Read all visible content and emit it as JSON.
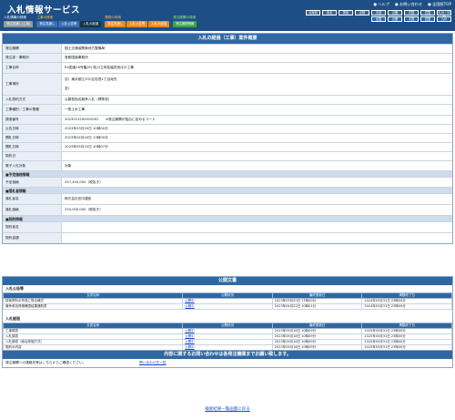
{
  "header": {
    "title": "入札情報サービス",
    "links": [
      "● ヘルプ",
      "● お問い合わせ",
      "● 全国版TOP"
    ],
    "regions_row1": [
      "北海道",
      "東北",
      "関東",
      "北陸",
      "中部",
      "近畿",
      "中国",
      "四国",
      "九州・沖縄"
    ],
    "regions_row2": [
      "全国",
      "近畿",
      "中国",
      "四国",
      "九州"
    ],
    "menu": [
      {
        "caption": "入札情報の検索",
        "tabs": [
          {
            "label": "発注見通し(工事)",
            "style": "gray"
          }
        ]
      },
      {
        "caption": "工事の検索",
        "tabs": [
          {
            "label": "発注見通し",
            "style": "blue"
          },
          {
            "label": "入札公告等",
            "style": "blue"
          },
          {
            "label": "入札の経過",
            "style": "dark"
          }
        ]
      },
      {
        "caption": "業務の検索",
        "tabs": [
          {
            "label": "発注見通し",
            "style": "orange"
          },
          {
            "label": "入札公告等",
            "style": "orange"
          },
          {
            "label": "入札の経過",
            "style": "orange"
          }
        ]
      },
      {
        "caption": "発注機関の検索",
        "tabs": [
          {
            "label": "発注機関情報",
            "style": "green"
          }
        ]
      }
    ]
  },
  "detail": {
    "heading": "入札の経過（工事）案件概要",
    "rows": [
      {
        "label": "発注機関",
        "value": "国土交通省関東地方整備局"
      },
      {
        "label": "発注部・事務所",
        "value": "首都国道事務所"
      },
      {
        "label": "工事名称",
        "value": "R4国道16号亀戸小松川立体拡幅改良ほか工事"
      },
      {
        "label": "工事場所",
        "value": "自）東京都江戸川区松島1丁目地先",
        "value2": "至）"
      },
      {
        "label": "入札契約方式",
        "value": "公募型指名競争入札（標準型）"
      },
      {
        "label": "工事種別／工事の業種",
        "value": "一般土木工事"
      },
      {
        "label": "調達番号",
        "value": "2023031200010002　　※発注機関が独自に定めるコード"
      },
      {
        "label": "公告日時",
        "value": "2023年03月20日 10時00分"
      },
      {
        "label": "開札日時",
        "value": "2023年04月04日 13時00分"
      },
      {
        "label": "開札日時",
        "value": "2023年05月15日 10時07分"
      },
      {
        "label": "契約日",
        "value": ""
      },
      {
        "label": "電子入札対象",
        "value": "対象"
      }
    ],
    "price_section": "■予定価格情報",
    "price_rows": [
      {
        "label": "予定価格",
        "value": "257,450,000（税抜き）"
      }
    ],
    "winner_section": "■落札者情報",
    "winner_rows": [
      {
        "label": "落札者名",
        "value": "株式会社田中建設"
      },
      {
        "label": "落札価格",
        "value": "255,000,000（税抜き）"
      }
    ],
    "contract_section": "■契約情報",
    "contract_rows": [
      {
        "label": "契約者名",
        "value": ""
      },
      {
        "label": "契約金額",
        "value": ""
      }
    ]
  },
  "public_docs": {
    "heading": "公開文書",
    "groups": [
      {
        "title": "入札公告等",
        "columns": [
          "文書名称",
          "公開状況",
          "最終更新日",
          "掲載終了日"
        ],
        "rows": [
          [
            "技術資料の作成に係る様式",
            "公開中",
            "2023年03月20日 17時00分",
            "2024年03月31日 23時00分"
          ],
          [
            "競争参加資格確認結果通知書",
            "公開中",
            "2023年04月22日 10時01分",
            "2024年03月31日 23時00分"
          ]
        ]
      },
      {
        "title": "入札経過",
        "columns": [
          "文書名称",
          "公開状況",
          "最終更新日",
          "掲載終了日"
        ],
        "rows": [
          [
            "工事調書",
            "公開中",
            "2023年05月18日 10時09分",
            "2025年03月31日 23時00分"
          ],
          [
            "入札調書",
            "公開中",
            "2023年05月18日 10時09分",
            "2025年03月31日 23時00分"
          ],
          [
            "入札調書（総合評価方式）",
            "公開中",
            "2023年05月18日 10時09分",
            "2025年03月31日 23時00分"
          ],
          [
            "契約の内容",
            "公開中",
            "2023年05月18日 10時09分",
            "2025年03月31日 23時00分"
          ]
        ]
      }
    ]
  },
  "inquiry": {
    "heading": "内容に関するお問い合わせは各発注機関までお願い致します。",
    "label": "発注機関への連絡先等はこちらからご確認ください。",
    "link": "問い合わせ先一覧"
  },
  "footer": {
    "back": "検索結果一覧画面に戻る"
  },
  "colors": {
    "header": "#1d4f86",
    "section": "#2f67a3",
    "label_bg": "#e8eef6",
    "link": "#1a4fc2"
  }
}
